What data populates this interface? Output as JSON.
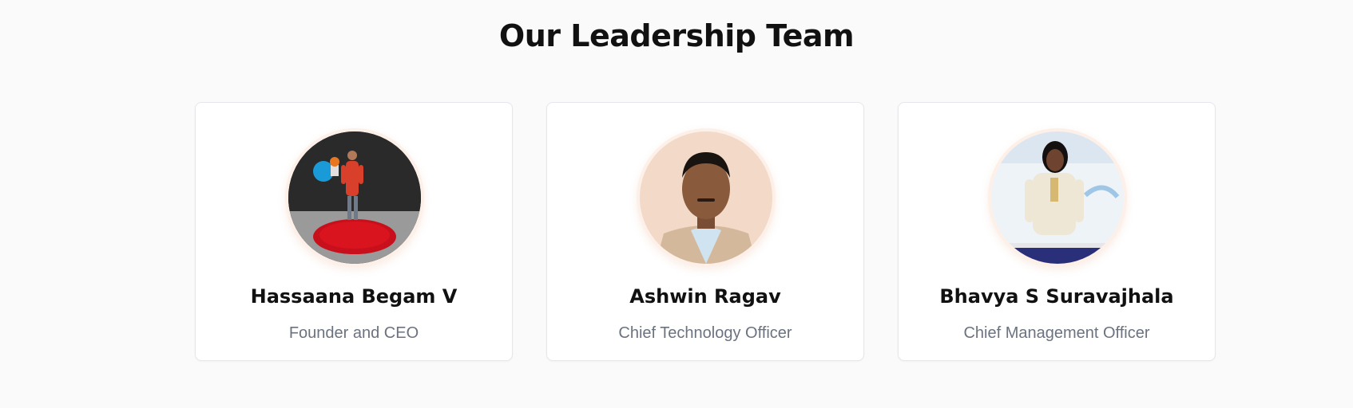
{
  "section": {
    "title": "Our Leadership Team"
  },
  "team": [
    {
      "name": "Hassaana Begam V",
      "role": "Founder and CEO",
      "photo_icon": "speaker-stage-photo"
    },
    {
      "name": "Ashwin Ragav",
      "role": "Chief Technology Officer",
      "photo_icon": "portrait-photo"
    },
    {
      "name": "Bhavya S Suravajhala",
      "role": "Chief Management Officer",
      "photo_icon": "presenter-photo"
    }
  ],
  "colors": {
    "background": "#fafafa",
    "card": "#ffffff",
    "ring": "#fdf0e8",
    "name": "#111111",
    "role": "#6b7280"
  }
}
